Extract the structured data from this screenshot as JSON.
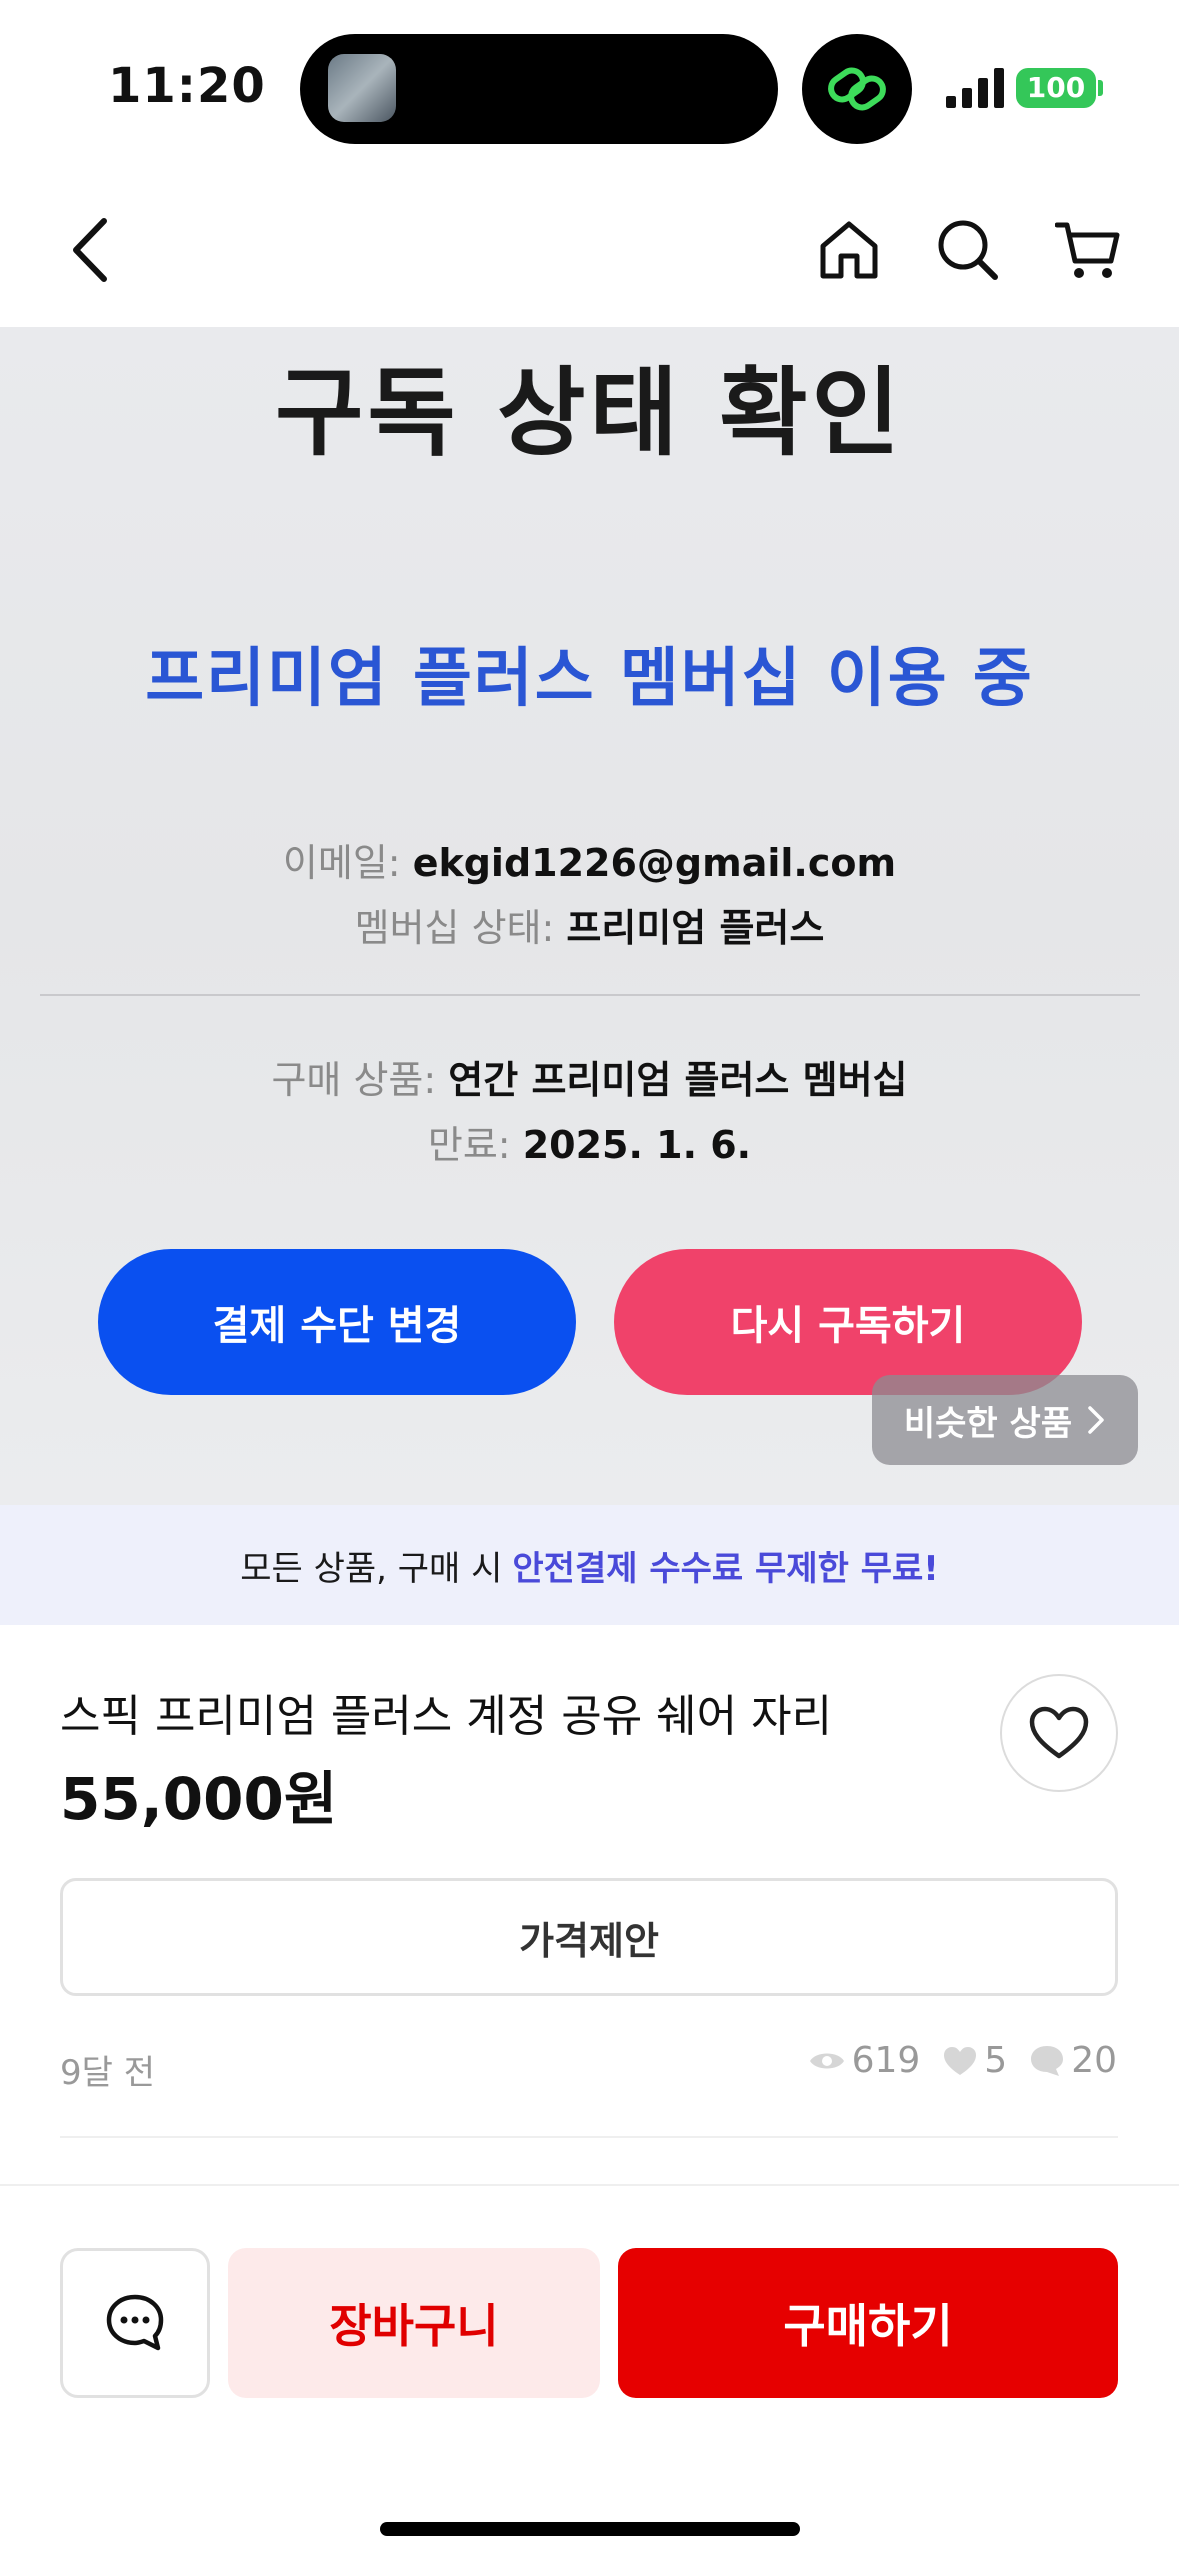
{
  "status_bar": {
    "time": "11:20",
    "battery": "100",
    "battery_color": "#34c759"
  },
  "nav": {
    "back_icon": "chevron-left-icon",
    "home_icon": "home-icon",
    "search_icon": "search-icon",
    "cart_icon": "cart-icon"
  },
  "hero": {
    "title": "구독 상태 확인",
    "membership_status": "프리미엄 플러스 멤버십 이용 중",
    "email_label": "이메일:",
    "email_value": "ekgid1226@gmail.com",
    "status_label": "멤버십 상태:",
    "status_value": "프리미엄 플러스",
    "product_label": "구매 상품:",
    "product_value": "연간 프리미엄 플러스 멤버십",
    "expiry_label": "만료:",
    "expiry_value": "2025. 1. 6.",
    "change_payment_label": "결제 수단 변경",
    "resubscribe_label": "다시 구독하기",
    "similar_label": "비슷한 상품"
  },
  "promo": {
    "text": "모든 상품, 구매 시",
    "highlight": "안전결제 수수료 무제한 무료!",
    "highlight_color": "#4a4ad9"
  },
  "product": {
    "title": "스픽 프리미엄 플러스 계정 공유 쉐어 자리",
    "price": "55,000원",
    "offer_label": "가격제안",
    "posted": "9달 전",
    "views": "619",
    "likes": "5",
    "chats": "20"
  },
  "bottom": {
    "cart_label": "장바구니",
    "buy_label": "구매하기",
    "accent_color": "#e60000"
  }
}
